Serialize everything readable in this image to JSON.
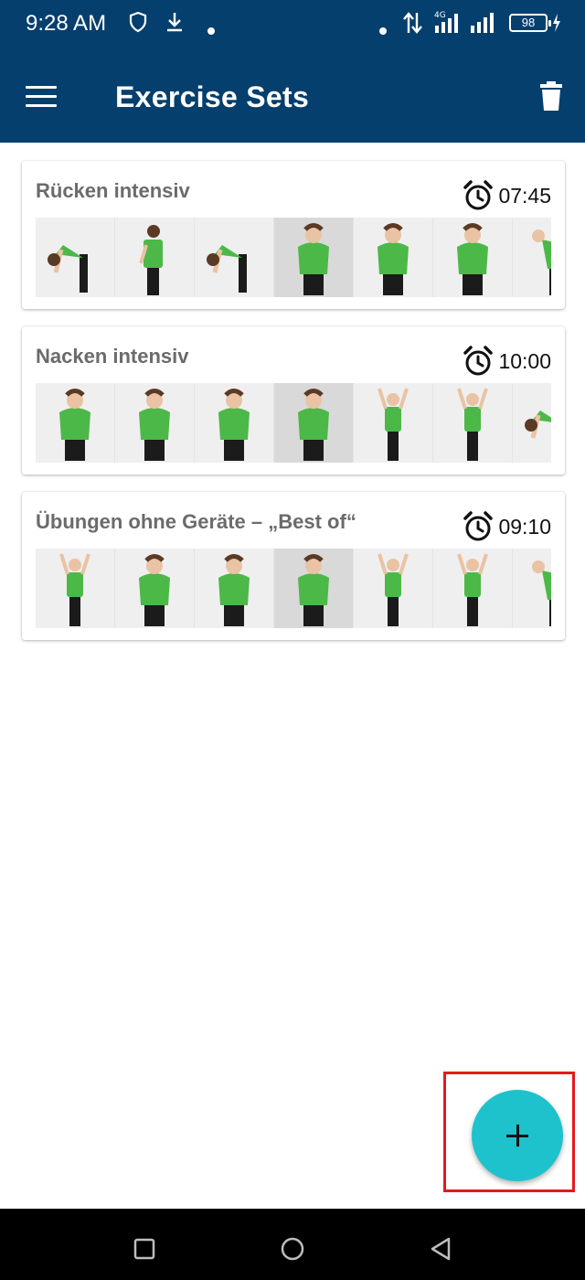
{
  "status_bar": {
    "time": "9:28 AM",
    "battery": "98",
    "icons": [
      "shield-icon",
      "download-icon",
      "dot-icon",
      "dot-icon",
      "data-transfer-icon",
      "signal-4g-icon",
      "signal-icon",
      "battery-icon",
      "charging-icon"
    ]
  },
  "app_bar": {
    "title": "Exercise Sets",
    "menu_icon": "menu-icon",
    "delete_icon": "trash-icon"
  },
  "exercise_sets": [
    {
      "title": "Rücken intensiv",
      "duration": "07:45",
      "icon": "alarm-clock-icon"
    },
    {
      "title": "Nacken intensiv",
      "duration": "10:00",
      "icon": "alarm-clock-icon"
    },
    {
      "title": "Übungen ohne Geräte – „Best of“",
      "duration": "09:10",
      "icon": "alarm-clock-icon"
    }
  ],
  "fab": {
    "icon": "plus-icon",
    "color": "#1ec2cc"
  },
  "colors": {
    "app_bar": "#053f6d",
    "shirt_green": "#4cb848",
    "highlight": "#e6191c"
  },
  "nav_bar": {
    "icons": [
      "recent-apps-icon",
      "home-icon",
      "back-icon"
    ]
  }
}
